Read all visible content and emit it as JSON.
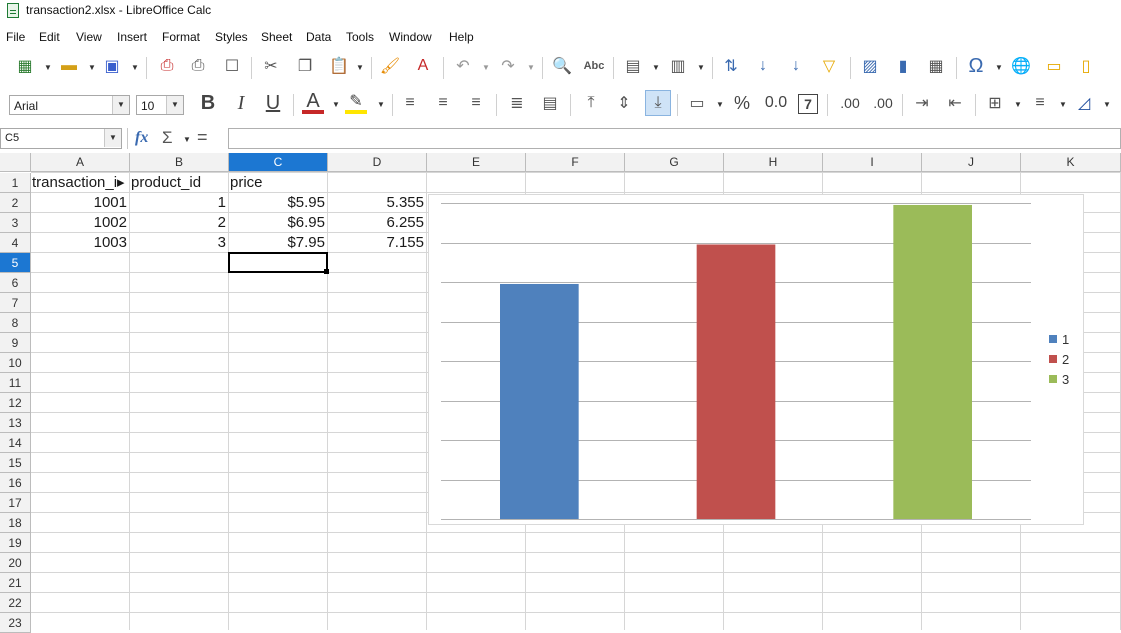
{
  "window": {
    "title": "transaction2.xlsx - LibreOffice Calc"
  },
  "menu": [
    "File",
    "Edit",
    "View",
    "Insert",
    "Format",
    "Styles",
    "Sheet",
    "Data",
    "Tools",
    "Window",
    "Help"
  ],
  "formatting": {
    "font_name": "Arial",
    "font_size": "10",
    "percent_symbol": "%",
    "number_format_label": "0.0",
    "integer_label": "7",
    "decimal_add_label": ".00",
    "decimal_remove_label": ".00"
  },
  "formula_bar": {
    "name_box": "C5",
    "fx": "fx",
    "sum": "Σ",
    "equals": "=",
    "content": ""
  },
  "columns": [
    "A",
    "B",
    "C",
    "D",
    "E",
    "F",
    "G",
    "H",
    "I",
    "J",
    "K"
  ],
  "selected_column": "C",
  "rows": [
    "1",
    "2",
    "3",
    "4",
    "5",
    "6",
    "7",
    "8",
    "9",
    "10",
    "11",
    "12",
    "13",
    "14",
    "15",
    "16",
    "17",
    "18",
    "19",
    "20",
    "21",
    "22",
    "23"
  ],
  "selected_row": "5",
  "sheet": {
    "headers": [
      "transaction_i▸",
      "product_id",
      "price",
      ""
    ],
    "data": [
      [
        "1001",
        "1",
        "$5.95",
        "5.355"
      ],
      [
        "1002",
        "2",
        "$6.95",
        "6.255"
      ],
      [
        "1003",
        "3",
        "$7.95",
        "7.155"
      ]
    ]
  },
  "chart_data": {
    "type": "bar",
    "categories": [
      "1",
      "2",
      "3"
    ],
    "values": [
      5.95,
      6.95,
      7.95
    ],
    "colors": [
      "#4f81bd",
      "#c0504d",
      "#9bbb59"
    ],
    "legend": [
      "1",
      "2",
      "3"
    ],
    "legend_position": "right",
    "ylim": [
      0,
      8
    ],
    "grid": true,
    "title": "",
    "xlabel": "",
    "ylabel": ""
  },
  "colors": {
    "selection_blue": "#1c77d2",
    "header_bg": "#f2f2f2"
  }
}
